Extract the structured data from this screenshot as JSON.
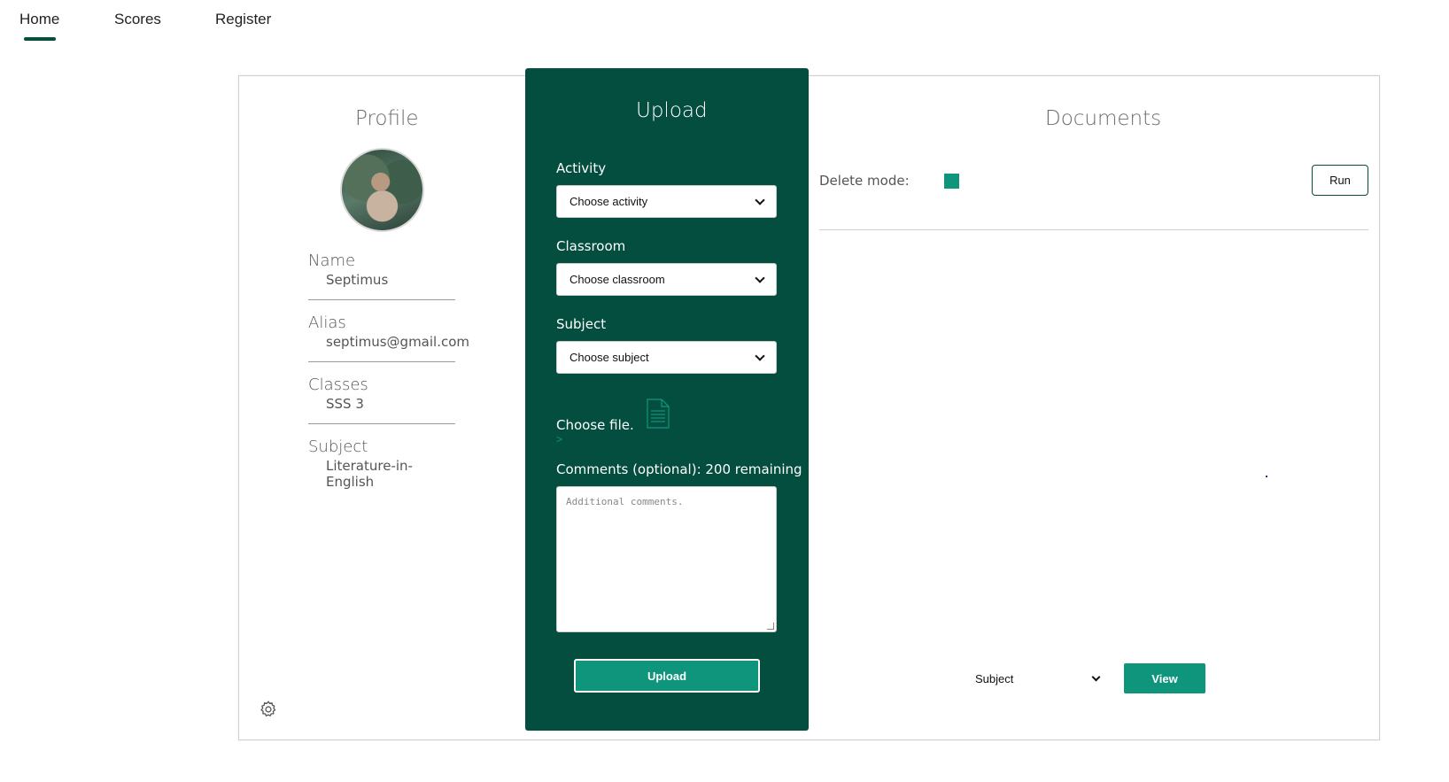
{
  "nav": {
    "items": [
      {
        "label": "Home"
      },
      {
        "label": "Scores"
      },
      {
        "label": "Register"
      }
    ]
  },
  "profile": {
    "title": "Profile",
    "fields": [
      {
        "label": "Name",
        "value": "Septimus"
      },
      {
        "label": "Alias",
        "value": "septimus@gmail.com"
      },
      {
        "label": "Classes",
        "value": "SSS 3"
      },
      {
        "label": "Subject",
        "value": "Literature-in-English"
      }
    ]
  },
  "upload": {
    "title": "Upload",
    "activity_label": "Activity",
    "activity_value": "Choose activity",
    "classroom_label": "Classroom",
    "classroom_value": "Choose classroom",
    "subject_label": "Subject",
    "subject_value": "Choose subject",
    "file_label": "Choose file.",
    "arrow": ">",
    "comments_label": "Comments (optional): 200 remaining",
    "comments_placeholder": "Additional comments.",
    "button_label": "Upload"
  },
  "documents": {
    "title": "Documents",
    "delete_label": "Delete mode:",
    "run_label": "Run",
    "subject_filter": "Subject",
    "view_label": "View"
  },
  "colors": {
    "dark_green": "#044e3f",
    "accent_green": "#10957d"
  },
  "icons": {
    "settings": "gear-icon",
    "file": "document-icon"
  }
}
